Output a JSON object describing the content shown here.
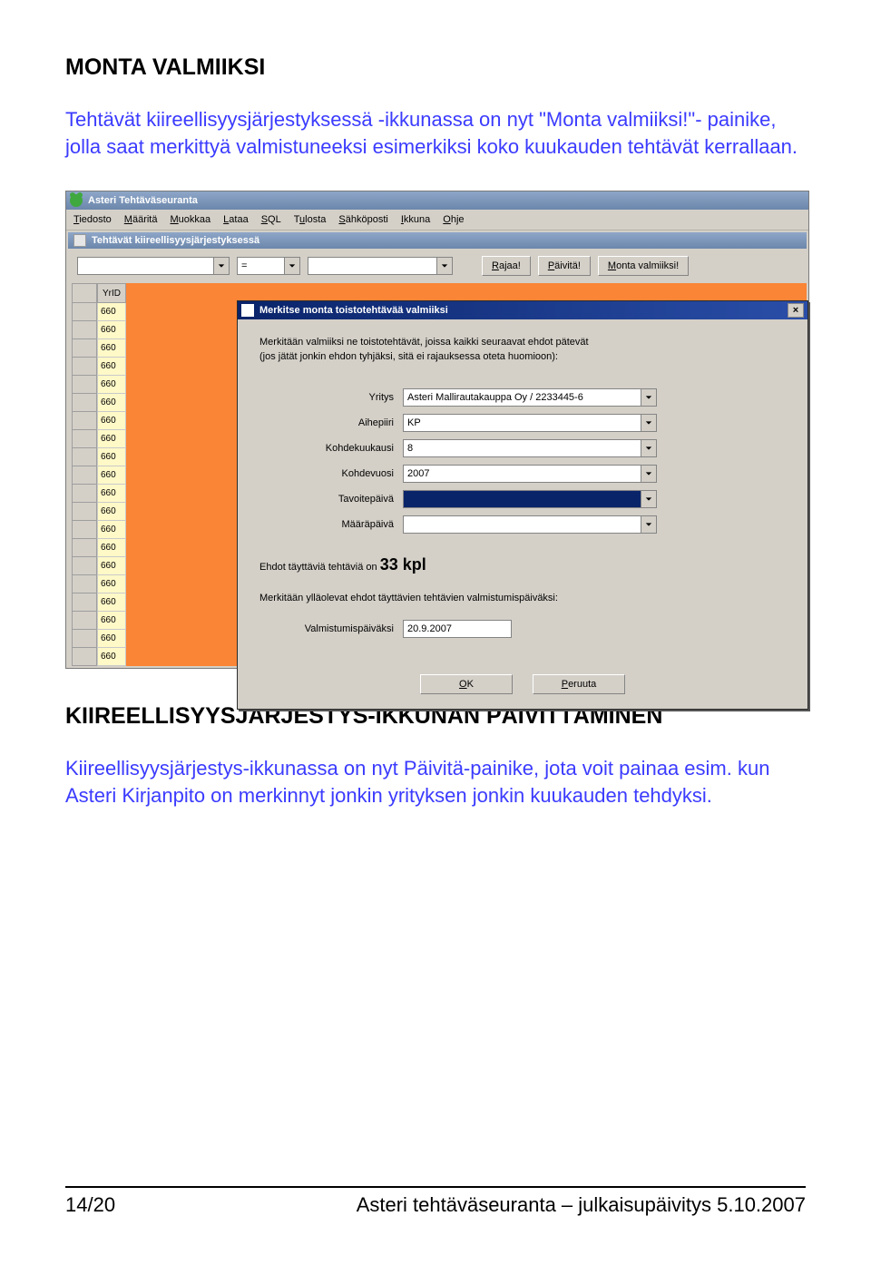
{
  "doc": {
    "heading1": "MONTA VALMIIKSI",
    "para1_prefix": "Tehtävät kiireellisyysjärjestyksessä -ikkunassa on nyt ",
    "para1_button": "\"Monta valmiiksi!\"",
    "para1_suffix": "- painike, jolla saat merkittyä valmistuneeksi esimerkiksi koko kuukauden tehtävät kerrallaan.",
    "heading2": "KIIREELLISYYSJÄRJESTYS-IKKUNAN PÄIVITTÄMINEN",
    "para2": "Kiireellisyysjärjestys-ikkunassa on nyt Päivitä-painike, jota voit painaa esim. kun Asteri Kirjanpito on merkinnyt jonkin yrityksen jonkin kuukauden tehdyksi.",
    "footer_left": "14/20",
    "footer_right": "Asteri tehtäväseuranta – julkaisupäivitys 5.10.2007"
  },
  "app": {
    "title": "Asteri Tehtäväseuranta",
    "menus": [
      "Tiedosto",
      "Määritä",
      "Muokkaa",
      "Lataa",
      "SQL",
      "Tulosta",
      "Sähköposti",
      "Ikkuna",
      "Ohje"
    ],
    "subwindow_title": "Tehtävät kiireellisyysjärjestyksessä",
    "filter": {
      "op": "=",
      "btn_rajaa": "Rajaa!",
      "btn_paivita": "Päivitä!",
      "btn_monta": "Monta valmiiksi!"
    },
    "col_head": "YrID",
    "rows": [
      "660",
      "660",
      "660",
      "660",
      "660",
      "660",
      "660",
      "660",
      "660",
      "660",
      "660",
      "660",
      "660",
      "660",
      "660",
      "660",
      "660",
      "660",
      "660",
      "660"
    ]
  },
  "dialog": {
    "title": "Merkitse monta toistotehtävää valmiiksi",
    "intro1": "Merkitään valmiiksi ne toistotehtävät, joissa kaikki seuraavat ehdot pätevät",
    "intro2": "(jos jätät jonkin ehdon tyhjäksi, sitä ei rajauksessa oteta huomioon):",
    "labels": {
      "yritys": "Yritys",
      "aihepiiri": "Aihepiiri",
      "kohdekuukausi": "Kohdekuukausi",
      "kohdevuosi": "Kohdevuosi",
      "tavoitepaiva": "Tavoitepäivä",
      "maarapaiva": "Määräpäivä",
      "valmistumispv": "Valmistumispäiväksi"
    },
    "values": {
      "yritys": "Asteri Mallirautakauppa Oy / 2233445-6",
      "aihepiiri": "KP",
      "kohdekuukausi": "8",
      "kohdevuosi": "2007",
      "tavoitepaiva": "",
      "maarapaiva": "",
      "valmistumispv": "20.9.2007"
    },
    "count_text": "Ehdot täyttäviä tehtäviä on  ",
    "count_value": "33 kpl",
    "note": "Merkitään ylläolevat ehdot täyttävien tehtävien valmistumispäiväksi:",
    "btn_ok": "OK",
    "btn_cancel": "Peruuta"
  }
}
